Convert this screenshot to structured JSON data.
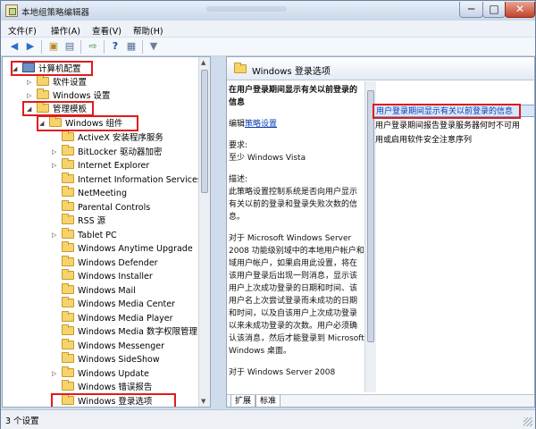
{
  "window": {
    "title": "本地组策略编辑器",
    "controls": {
      "minimize": "─",
      "maximize": "□",
      "close": "✕"
    }
  },
  "menu": [
    "文件(F)",
    "操作(A)",
    "查看(V)",
    "帮助(H)"
  ],
  "toolbar_icons": [
    "back-icon",
    "forward-icon",
    "up-folder-icon",
    "show-hide-tree-icon",
    "export-list-icon",
    "help-icon",
    "properties-icon",
    "filter-icon"
  ],
  "tree": {
    "root": "计算机配置",
    "software": "软件设置",
    "windows_settings": "Windows 设置",
    "admin_templates": "管理模板",
    "windows_components": "Windows 组件",
    "items": [
      "ActiveX 安装程序服务",
      "BitLocker 驱动器加密",
      "Internet Explorer",
      "Internet Information Services",
      "NetMeeting",
      "Parental Controls",
      "RSS 源",
      "Tablet PC",
      "Windows Anytime Upgrade",
      "Windows Defender",
      "Windows Installer",
      "Windows Mail",
      "Windows Media Center",
      "Windows Media Player",
      "Windows Media 数字权限管理",
      "Windows Messenger",
      "Windows SideShow",
      "Windows Update",
      "Windows 错误报告",
      "Windows 登录选项"
    ]
  },
  "right": {
    "header": "Windows 登录选项",
    "desc_title": "在用户登录期间显示有关以前登录的信息",
    "edit_prefix": "编辑",
    "edit_link": "策略设置",
    "req_label": "要求:",
    "req_value": "至少 Windows Vista",
    "desc_label": "描述:",
    "desc_text": "此策略设置控制系统是否向用户显示有关以前的登录和登录失败次数的信息。",
    "desc_text2": "对于 Microsoft Windows Server 2008 功能级别域中的本地用户帐户和域用户帐户，如果启用此设置，将在该用户登录后出现一则消息，显示该用户上次成功登录的日期和时间、该用户名上次尝试登录而未成功的日期和时间，以及自该用户上次成功登录以来未成功登录的次数。用户必须确认该消息，然后才能登录到 Microsoft Windows 桌面。",
    "desc_text3": "对于 Windows Server 2008",
    "settings": [
      "用户登录期间显示有关以前登录的信息",
      "用户登录期间报告登录服务器何时不可用",
      "用或启用软件安全注意序列"
    ],
    "tabs": [
      "扩展",
      "标准"
    ]
  },
  "status": "3 个设置"
}
